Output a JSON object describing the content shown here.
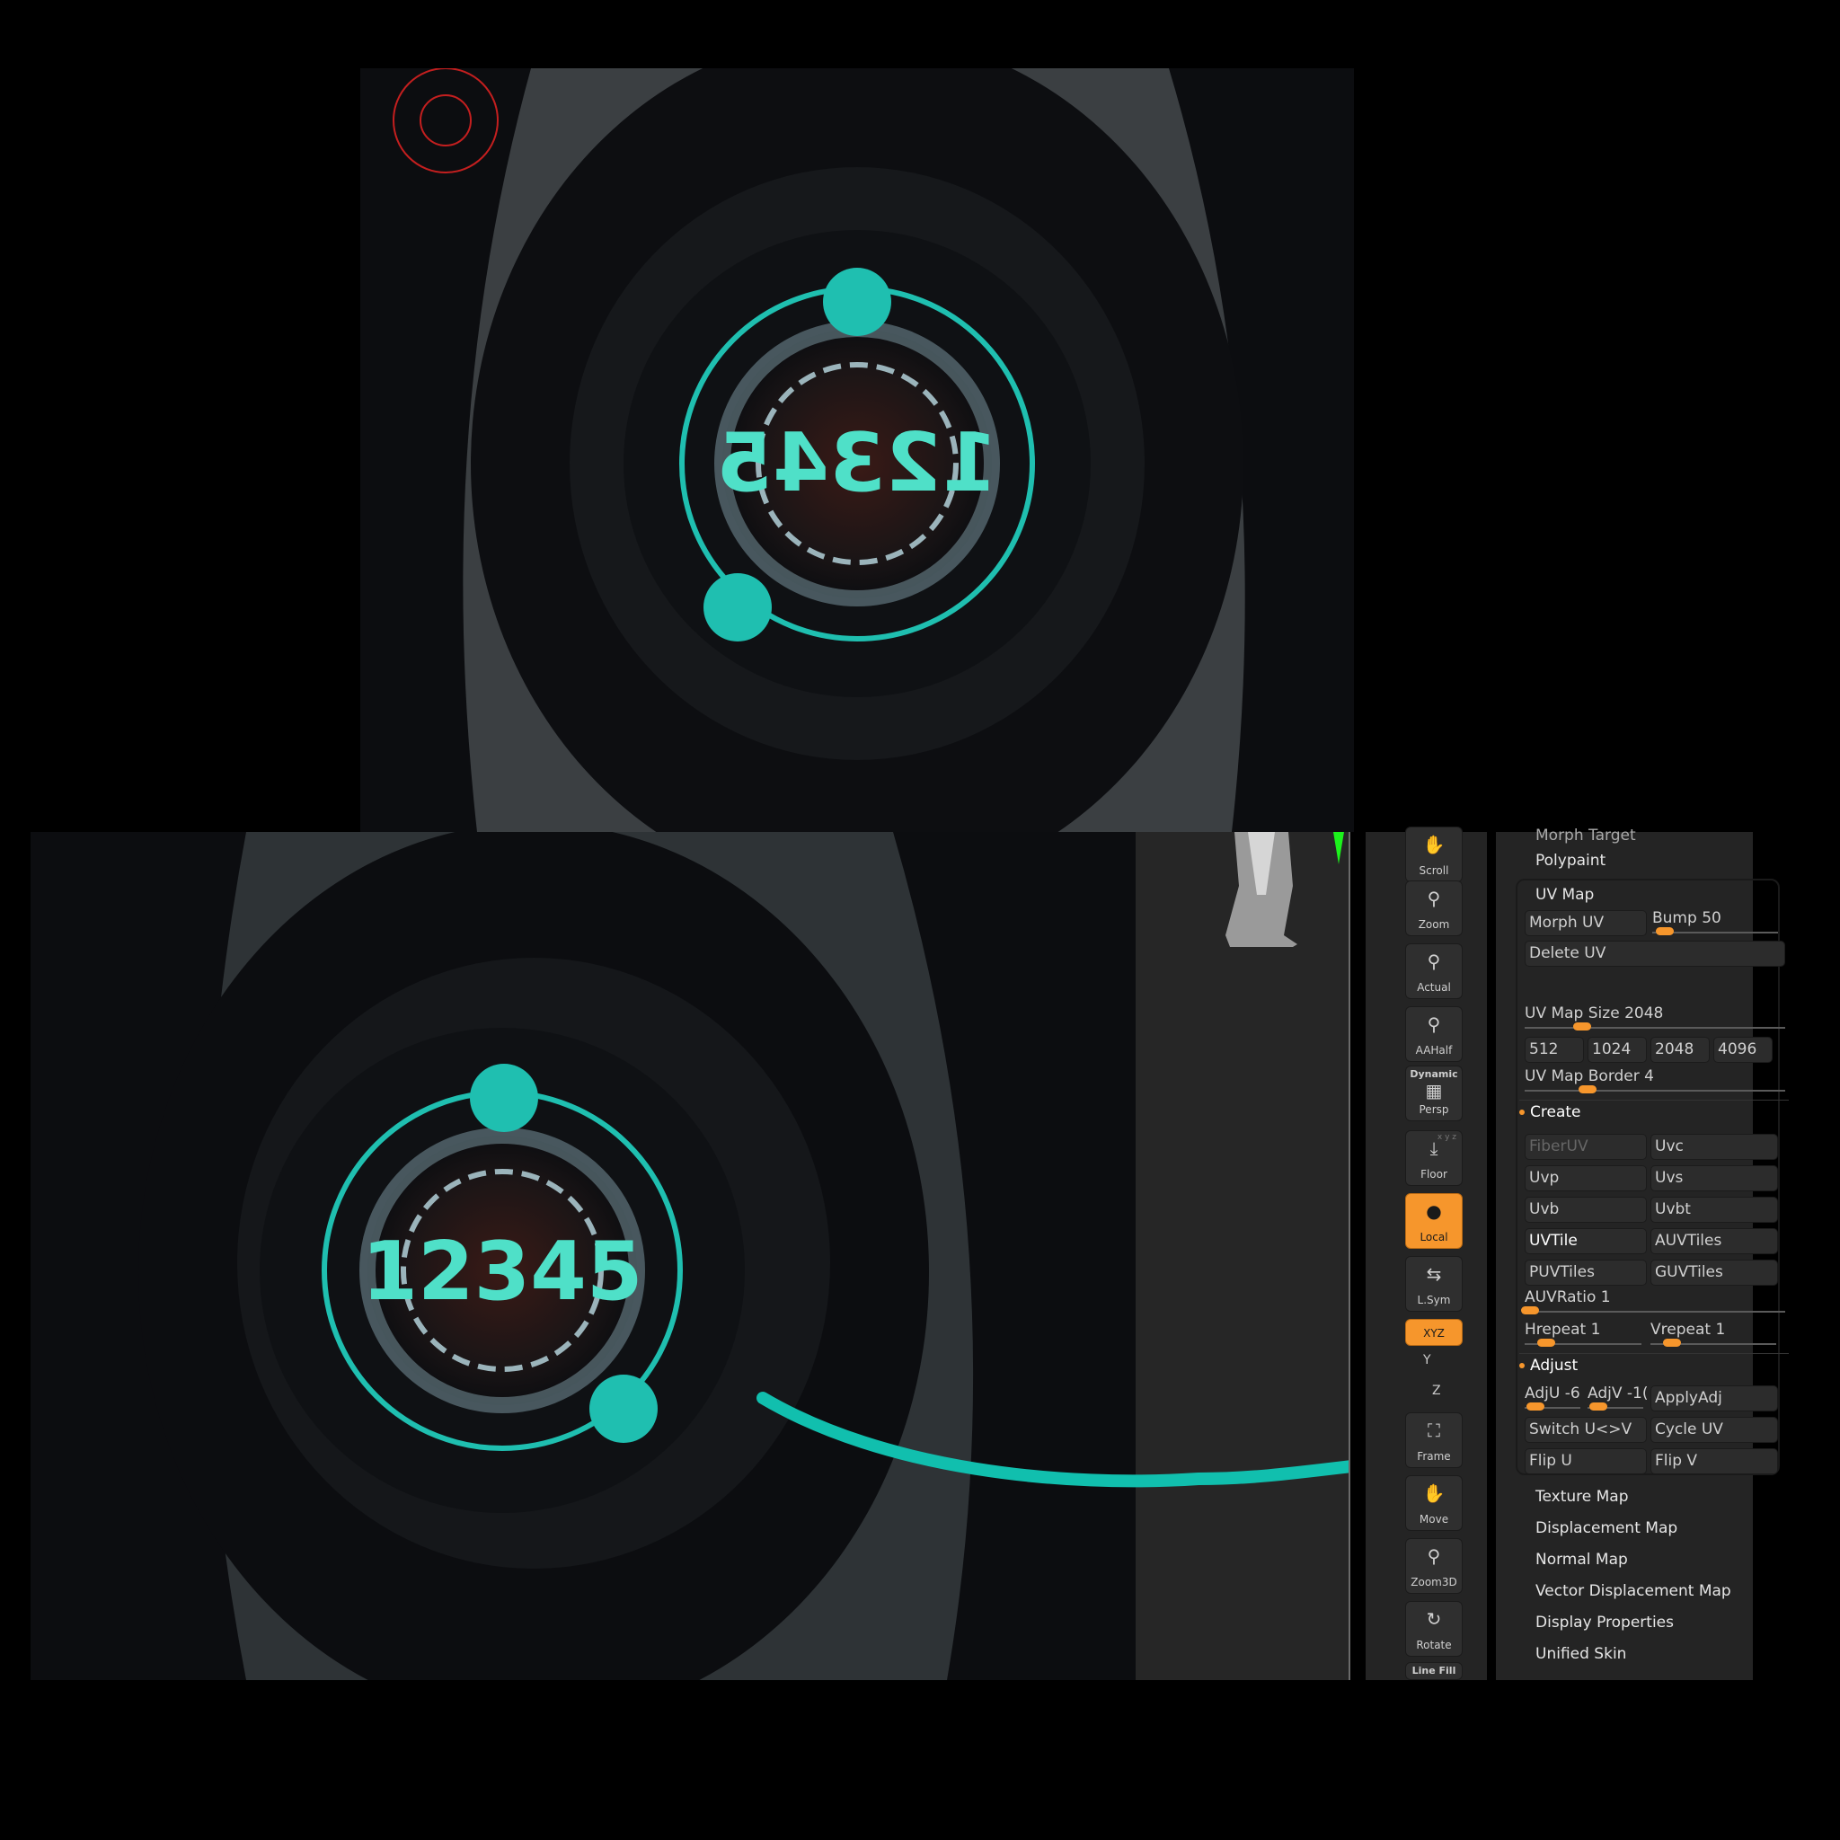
{
  "viewport_top": {
    "hud_number": "12345",
    "hud_mirrored": true,
    "accent_color": "#1fbfb0"
  },
  "viewport_bottom": {
    "hud_number": "12345",
    "accent_color": "#1fbfb0"
  },
  "annotation": {
    "type": "arrow",
    "color": "#11bfae"
  },
  "toolbar": {
    "tools": [
      {
        "label": "Scroll",
        "icon": "scroll-hand-icon",
        "active": false
      },
      {
        "label": "Zoom",
        "icon": "zoom-magnifier-icon",
        "active": false
      },
      {
        "label": "Actual",
        "icon": "actual-x1-icon",
        "active": false
      },
      {
        "label": "AAHalf",
        "icon": "aahalf-icon",
        "active": false
      },
      {
        "label": "Persp",
        "top_label": "Dynamic",
        "icon": "perspective-grid-icon",
        "active": false
      },
      {
        "label": "Floor",
        "axes": "x y z",
        "icon": "floor-icon",
        "active": false
      },
      {
        "label": "Local",
        "icon": "local-symmetry-icon",
        "active": true
      },
      {
        "label": "L.Sym",
        "icon": "lsym-arrows-icon",
        "active": false
      },
      {
        "label": "XYZ",
        "icon": "rotate-xyz-icon",
        "active": true
      },
      {
        "label": "Y",
        "icon": "rotate-y-icon",
        "active": false
      },
      {
        "label": "Z",
        "icon": "rotate-z-icon",
        "active": false
      },
      {
        "label": "Frame",
        "icon": "frame-icon",
        "active": false
      },
      {
        "label": "Move",
        "icon": "move-hand-icon",
        "active": false
      },
      {
        "label": "Zoom3D",
        "icon": "zoom3d-icon",
        "active": false
      },
      {
        "label": "Rotate",
        "icon": "rotate-icon",
        "active": false
      },
      {
        "label": "Line Fill",
        "icon": "line-fill-icon",
        "active": false
      }
    ]
  },
  "uv_panel": {
    "menu_above": [
      "Morph Target",
      "Polypaint"
    ],
    "title": "UV Map",
    "morph_uv": "Morph UV",
    "bump": {
      "label": "Bump",
      "value": "50",
      "fraction": 0.05
    },
    "delete_uv": "Delete UV",
    "map_size": {
      "label": "UV Map Size",
      "value": "2048",
      "fraction": 0.25
    },
    "size_buttons": [
      "512",
      "1024",
      "2048",
      "4096"
    ],
    "map_border": {
      "label": "UV Map Border",
      "value": "4",
      "fraction": 0.25
    },
    "create": {
      "title": "Create",
      "buttons": [
        [
          "FiberUV",
          "Uvc"
        ],
        [
          "Uvp",
          "Uvs"
        ],
        [
          "Uvb",
          "Uvbt"
        ],
        [
          "UVTile",
          "AUVTiles"
        ],
        [
          "PUVTiles",
          "GUVTiles"
        ]
      ],
      "auv_ratio": {
        "label": "AUVRatio",
        "value": "1",
        "fraction": 0.0
      },
      "hrepeat": {
        "label": "Hrepeat",
        "value": "1",
        "fraction": 0.1
      },
      "vrepeat": {
        "label": "Vrepeat",
        "value": "1",
        "fraction": 0.1
      }
    },
    "adjust": {
      "title": "Adjust",
      "adju": {
        "label": "AdjU",
        "value": "-6"
      },
      "adjv": {
        "label": "AdjV",
        "value": "-1("
      },
      "apply": "ApplyAdj",
      "buttons": [
        [
          "Switch U<>V",
          "Cycle UV"
        ],
        [
          "Flip U",
          "Flip V"
        ]
      ]
    },
    "menu_below": [
      "Texture Map",
      "Displacement Map",
      "Normal Map",
      "Vector Displacement Map",
      "Display Properties",
      "Unified Skin"
    ]
  }
}
